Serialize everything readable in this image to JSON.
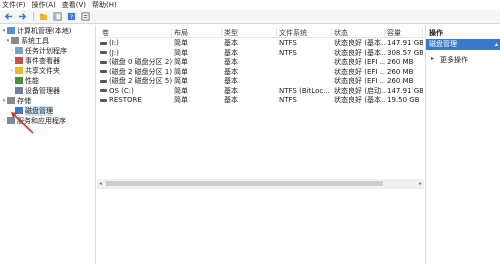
{
  "menu": [
    "文件(F)",
    "操作(A)",
    "查看(V)",
    "帮助(H)"
  ],
  "toolbar": [
    {
      "name": "back-icon",
      "color": "#3a7bd5"
    },
    {
      "name": "forward-icon",
      "color": "#3a7bd5"
    },
    {
      "name": "up-folder-icon",
      "color": "#d9a520"
    },
    {
      "name": "console-tree-icon",
      "color": "#6b6b6b"
    },
    {
      "name": "help-icon",
      "color": "#3a7bd5"
    },
    {
      "name": "properties-icon",
      "color": "#6b6b6b"
    },
    {
      "name": "refresh-icon",
      "color": "#4a8f3c"
    }
  ],
  "tree": {
    "root": "计算机管理(本地)",
    "system_tools": "系统工具",
    "task_scheduler": "任务计划程序",
    "event_viewer": "事件查看器",
    "shared_folders": "共享文件夹",
    "performance": "性能",
    "device_manager": "设备管理器",
    "storage": "存储",
    "disk_management": "磁盘管理",
    "services_apps": "服务和应用程序"
  },
  "table": {
    "headers": [
      "卷",
      "布局",
      "类型",
      "文件系统",
      "状态",
      "容量"
    ],
    "rows": [
      [
        "(I:)",
        "简单",
        "基本",
        "NTFS",
        "状态良好 (基本...",
        "147.91 GB"
      ],
      [
        "(J:)",
        "简单",
        "基本",
        "NTFS",
        "状态良好 (基本...",
        "308.57 GB"
      ],
      [
        "(磁盘 0 磁盘分区 2)",
        "简单",
        "基本",
        "",
        "状态良好 (EFI ...",
        "260 MB"
      ],
      [
        "(磁盘 2 磁盘分区 1)",
        "简单",
        "基本",
        "",
        "状态良好 (EFI ...",
        "260 MB"
      ],
      [
        "(磁盘 2 磁盘分区 5)",
        "简单",
        "基本",
        "",
        "状态良好 (EFI ...",
        "260 MB"
      ],
      [
        "OS (C:)",
        "简单",
        "基本",
        "NTFS (BitLoc...",
        "状态良好 (启动...",
        "147.91 GB"
      ],
      [
        "RESTORE",
        "简单",
        "基本",
        "NTFS",
        "状态良好 (基本...",
        "19.50 GB"
      ]
    ]
  },
  "actions": {
    "title": "操作",
    "section": "磁盘管理",
    "more": "更多操作"
  },
  "annotation": {
    "arrow_color": "#d0342c"
  }
}
